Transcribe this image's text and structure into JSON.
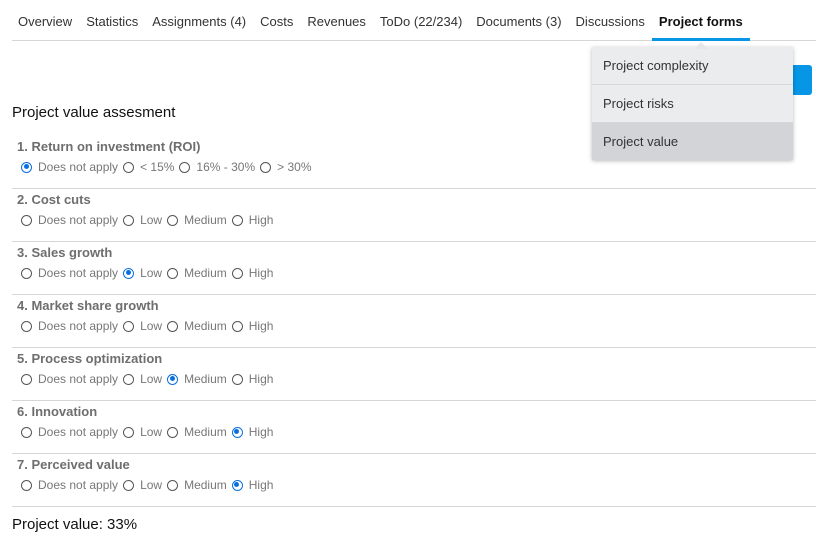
{
  "tabs": [
    {
      "label": "Overview",
      "active": false
    },
    {
      "label": "Statistics",
      "active": false
    },
    {
      "label": "Assignments (4)",
      "active": false
    },
    {
      "label": "Costs",
      "active": false
    },
    {
      "label": "Revenues",
      "active": false
    },
    {
      "label": "ToDo (22/234)",
      "active": false
    },
    {
      "label": "Documents (3)",
      "active": false
    },
    {
      "label": "Discussions",
      "active": false
    },
    {
      "label": "Project forms",
      "active": true
    }
  ],
  "dropdown": {
    "items": [
      {
        "label": "Project complexity",
        "selected": false
      },
      {
        "label": "Project risks",
        "selected": false
      },
      {
        "label": "Project value",
        "selected": true
      }
    ]
  },
  "colors": {
    "accent": "#0795e6",
    "radio_checked": "#0a6fde"
  },
  "form": {
    "title": "Project value assesment",
    "questions": [
      {
        "label": "1. Return on investment (ROI)",
        "options": [
          "Does not apply",
          "< 15%",
          "16% - 30%",
          "> 30%"
        ],
        "selected": 0
      },
      {
        "label": "2. Cost cuts",
        "options": [
          "Does not apply",
          "Low",
          "Medium",
          "High"
        ],
        "selected": null
      },
      {
        "label": "3. Sales growth",
        "options": [
          "Does not apply",
          "Low",
          "Medium",
          "High"
        ],
        "selected": 1
      },
      {
        "label": "4. Market share growth",
        "options": [
          "Does not apply",
          "Low",
          "Medium",
          "High"
        ],
        "selected": null
      },
      {
        "label": "5. Process optimization",
        "options": [
          "Does not apply",
          "Low",
          "Medium",
          "High"
        ],
        "selected": 2
      },
      {
        "label": "6. Innovation",
        "options": [
          "Does not apply",
          "Low",
          "Medium",
          "High"
        ],
        "selected": 3
      },
      {
        "label": "7. Perceived value",
        "options": [
          "Does not apply",
          "Low",
          "Medium",
          "High"
        ],
        "selected": 3
      }
    ],
    "total_label": "Project value: 33%"
  }
}
